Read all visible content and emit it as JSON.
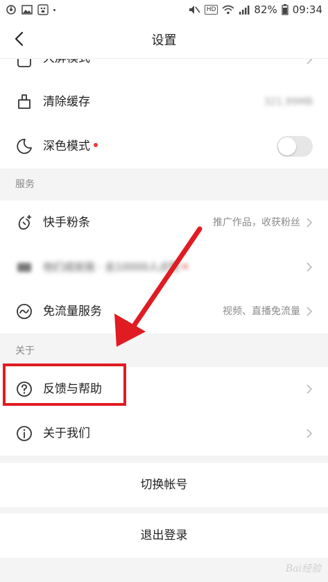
{
  "status_bar": {
    "hd": "HD",
    "battery": "82%",
    "time": "09:34"
  },
  "nav": {
    "title": "设置"
  },
  "rows": {
    "large_mode_label": "大屏模式",
    "clear_cache_label": "清除缓存",
    "clear_cache_value": "321.99MB",
    "dark_mode_label": "深色模式",
    "dark_mode_on": false,
    "fans_label": "快手粉条",
    "fans_sub": "推广作品，收获粉丝",
    "blurred_label": "他们成就我 · 去10000人点赞",
    "free_flow_label": "免流量服务",
    "free_flow_sub": "视频、直播免流量",
    "feedback_label": "反馈与帮助",
    "about_label": "关于我们"
  },
  "sections": {
    "service": "服务",
    "about": "关于"
  },
  "actions": {
    "switch_account": "切换帐号",
    "logout": "退出登录"
  },
  "watermark": "Bai经验",
  "colors": {
    "accent_red": "#e11b22",
    "dot_red": "#e93a3a"
  },
  "icons": {
    "back": "chevron-left-icon",
    "clear_cache": "broom-icon",
    "dark_mode": "moon-icon",
    "fans": "rocket-plus-icon",
    "free_flow": "wave-circle-icon",
    "feedback": "question-circle-icon",
    "about": "info-circle-icon"
  }
}
